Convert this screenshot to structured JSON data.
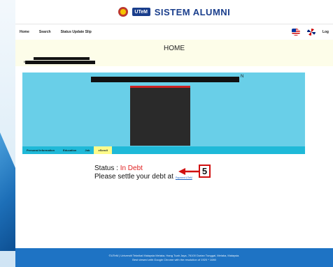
{
  "header": {
    "title": "SISTEM ALUMNI",
    "utem_logo_text": "UTeM"
  },
  "nav": {
    "items": [
      "Home",
      "Search",
      "Status Update Slip"
    ],
    "logout": "Log"
  },
  "home_heading": "HOME",
  "profile": {
    "name_label": "NAME : ",
    "header_trailing_letter": "N"
  },
  "tabs": [
    {
      "label": "Personal Information",
      "active": false
    },
    {
      "label": "Education",
      "active": false
    },
    {
      "label": "Job",
      "active": false
    },
    {
      "label": "eScroll",
      "active": true
    }
  ],
  "escroll": {
    "status_label": "Status : ",
    "status_value": "In Debt",
    "settle_text": "Please settle your debt at",
    "payment_link": "Payment UTeM"
  },
  "annotation": {
    "badge_number": "5"
  },
  "footer": {
    "line1": "©UTeM | Universiti Teknikal Malaysia Melaka, Hang Tuah Jaya, 76100 Durian Tunggal, Melaka, Malaysia.",
    "line2": "Best viewed with Google Chrome with the resolution of 1920 * 1080"
  },
  "colors": {
    "accent_blue": "#1a3e8c",
    "profile_bg": "#69cfe8",
    "tab_bar": "#1fb9d8",
    "active_tab": "#fffb8a",
    "debt_red": "#e02020",
    "footer_bg": "#1e73c4"
  }
}
